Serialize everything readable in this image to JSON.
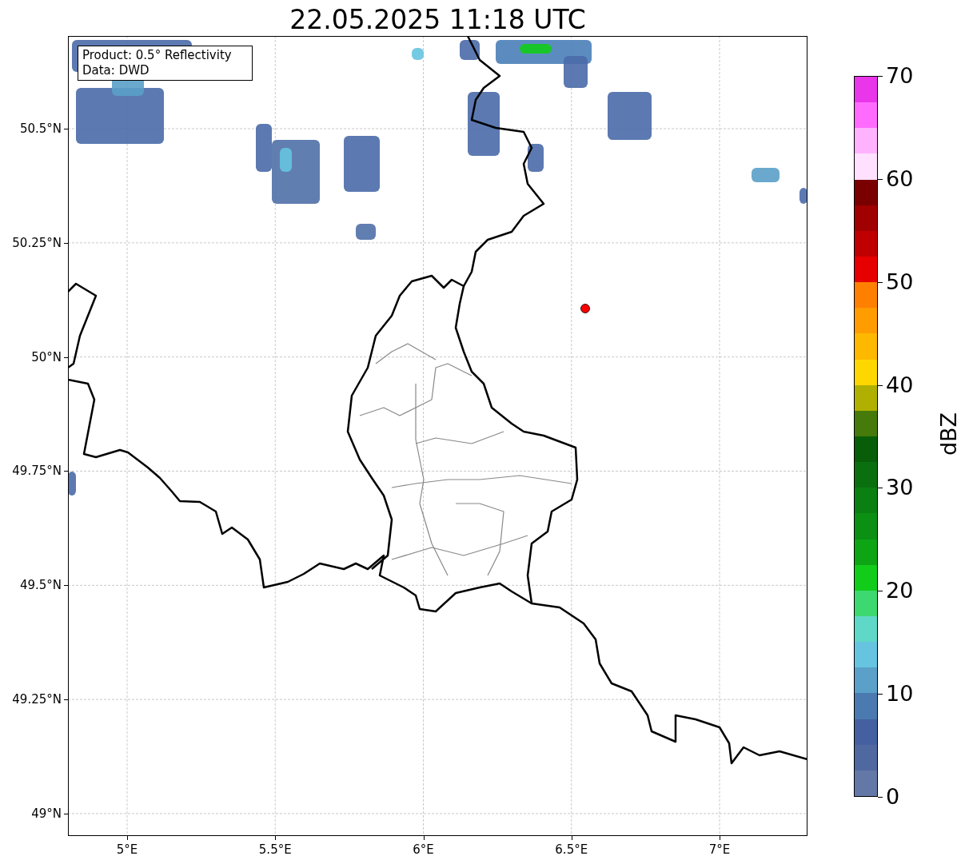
{
  "title": "22.05.2025 11:18 UTC",
  "info_box": [
    "Product: 0.5° Reflectivity",
    "Data: DWD"
  ],
  "map": {
    "x_tick_labels": [
      "5°E",
      "5.5°E",
      "6°E",
      "6.5°E",
      "7°E"
    ],
    "y_tick_labels": [
      "50.5°N",
      "50.25°N",
      "50°N",
      "49.75°N",
      "49.5°N",
      "49.25°N",
      "49°N"
    ]
  },
  "colorbar": {
    "label": "dBZ",
    "tick_labels": [
      "70",
      "60",
      "50",
      "40",
      "30",
      "20",
      "10",
      "0"
    ],
    "bins": [
      {
        "color": "#ea36ea"
      },
      {
        "color": "#ff6bff"
      },
      {
        "color": "#ffb3ff"
      },
      {
        "color": "#ffe0ff"
      },
      {
        "color": "#7a0000"
      },
      {
        "color": "#a00000"
      },
      {
        "color": "#c00000"
      },
      {
        "color": "#e60000"
      },
      {
        "color": "#ff8000"
      },
      {
        "color": "#ff9c00"
      },
      {
        "color": "#ffb800"
      },
      {
        "color": "#ffd700"
      },
      {
        "color": "#b0b000"
      },
      {
        "color": "#467a0a"
      },
      {
        "color": "#085e08"
      },
      {
        "color": "#0a700f"
      },
      {
        "color": "#0b8012"
      },
      {
        "color": "#0b9013"
      },
      {
        "color": "#0ea515"
      },
      {
        "color": "#12cc1a"
      },
      {
        "color": "#3dd870"
      },
      {
        "color": "#60d8c8"
      },
      {
        "color": "#66c4e0"
      },
      {
        "color": "#5aa0c8"
      },
      {
        "color": "#4a7ab0"
      },
      {
        "color": "#4460a0"
      },
      {
        "color": "#5068a0"
      },
      {
        "color": "#6478a8"
      }
    ]
  }
}
